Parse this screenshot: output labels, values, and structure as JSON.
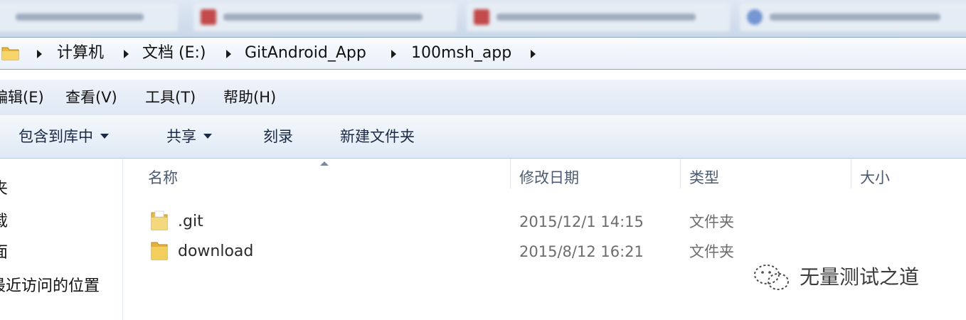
{
  "address": {
    "segments": [
      "计算机",
      "文档 (E:)",
      "GitAndroid_App",
      "100msh_app"
    ]
  },
  "menu": {
    "items": [
      "编辑(E)",
      "查看(V)",
      "工具(T)",
      "帮助(H)"
    ]
  },
  "toolbar": {
    "include_label": "包含到库中",
    "share_label": "共享",
    "burn_label": "刻录",
    "new_folder_label": "新建文件夹"
  },
  "nav": {
    "items": [
      "夹",
      "载",
      "面",
      "最近访问的位置"
    ]
  },
  "columns": {
    "name": "名称",
    "modified": "修改日期",
    "type": "类型",
    "size": "大小"
  },
  "files": [
    {
      "name": ".git",
      "modified": "2015/12/1 14:15",
      "type": "文件夹",
      "icon": "folder-icon"
    },
    {
      "name": "download",
      "modified": "2015/8/12 16:21",
      "type": "文件夹",
      "icon": "folder-icon"
    }
  ],
  "watermark": {
    "text": "无量测试之道"
  },
  "colors": {
    "folder": "#f2c94c",
    "chrome_blue": "#dfe8f4",
    "border": "#8fa6c4"
  }
}
